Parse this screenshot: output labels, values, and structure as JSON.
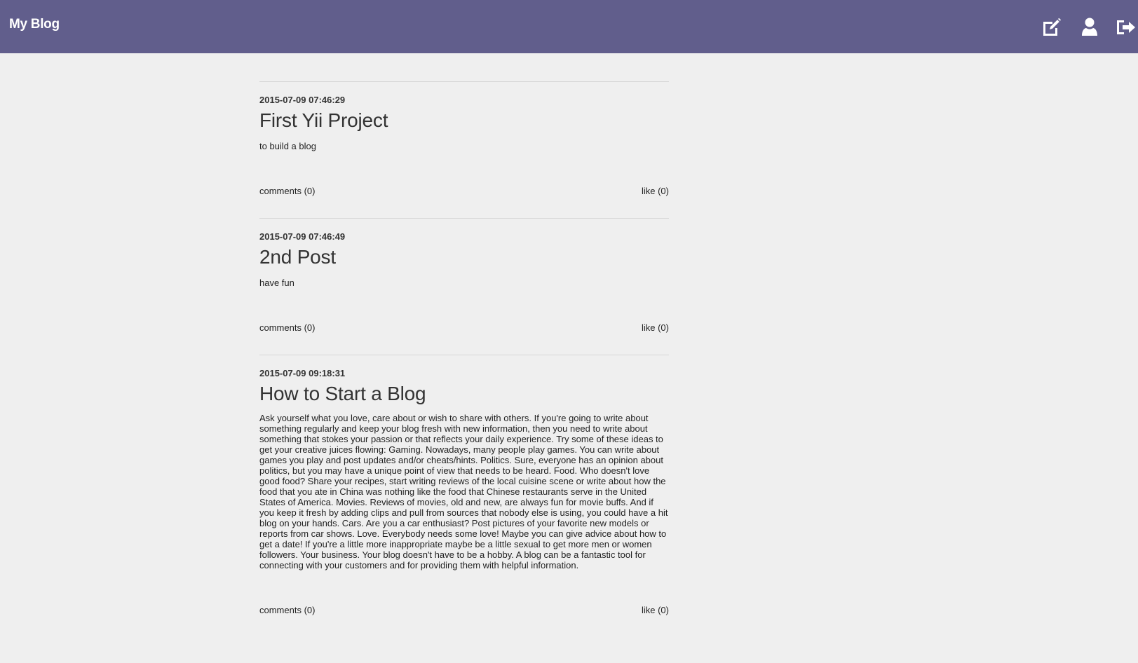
{
  "header": {
    "brand": "My Blog",
    "icons": [
      "edit-icon",
      "user-icon",
      "logout-icon"
    ]
  },
  "colors": {
    "navbar": "#615e8c",
    "background": "#efefef"
  },
  "posts": [
    {
      "date": "2015-07-09 07:46:29",
      "title": "First Yii Project",
      "body": "to build a blog",
      "comments": "comments (0)",
      "like": "like (0)"
    },
    {
      "date": "2015-07-09 07:46:49",
      "title": "2nd Post",
      "body": "have fun",
      "comments": "comments (0)",
      "like": "like (0)"
    },
    {
      "date": "2015-07-09 09:18:31",
      "title": "How to Start a Blog",
      "body": "Ask yourself what you love, care about or wish to share with others. If you're going to write about something regularly and keep your blog fresh with new information, then you need to write about something that stokes your passion or that reflects your daily experience. Try some of these ideas to get your creative juices flowing: Gaming. Nowadays, many people play games. You can write about games you play and post updates and/or cheats/hints. Politics. Sure, everyone has an opinion about politics, but you may have a unique point of view that needs to be heard. Food. Who doesn't love good food? Share your recipes, start writing reviews of the local cuisine scene or write about how the food that you ate in China was nothing like the food that Chinese restaurants serve in the United States of America. Movies. Reviews of movies, old and new, are always fun for movie buffs. And if you keep it fresh by adding clips and pull from sources that nobody else is using, you could have a hit blog on your hands. Cars. Are you a car enthusiast? Post pictures of your favorite new models or reports from car shows. Love. Everybody needs some love! Maybe you can give advice about how to get a date! If you're a little more inappropriate maybe be a little sexual to get more men or women followers. Your business. Your blog doesn't have to be a hobby. A blog can be a fantastic tool for connecting with your customers and for providing them with helpful information.",
      "comments": "comments (0)",
      "like": "like (0)"
    }
  ]
}
